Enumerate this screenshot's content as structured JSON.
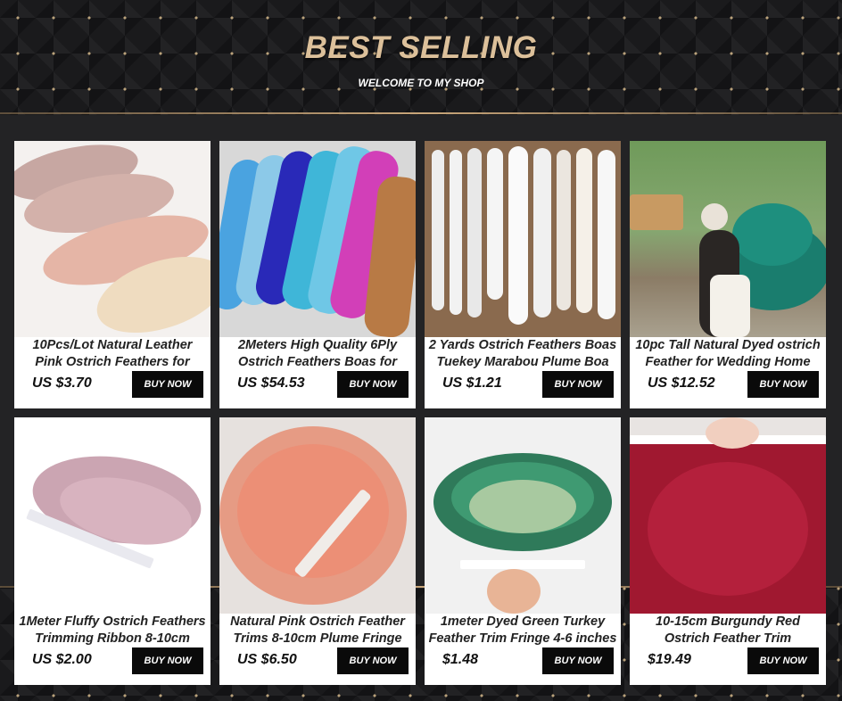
{
  "header": {
    "title": "BEST SELLING",
    "subtitle": "WELCOME TO MY SHOP"
  },
  "colors": {
    "gold": "#dcc09a",
    "background": "#1a1a1c",
    "button": "#0a0a0a"
  },
  "products": [
    {
      "line1": "10Pcs/Lot Natural Leather",
      "line2": "Pink Ostrich Feathers for",
      "price": "US $3.70",
      "button": "BUY NOW"
    },
    {
      "line1": "2Meters High Quality 6Ply",
      "line2": "Ostrich Feathers Boas for",
      "price": "US $54.53",
      "button": "BUY NOW"
    },
    {
      "line1": "2 Yards Ostrich Feathers Boas",
      "line2": "Tuekey Marabou Plume Boa",
      "price": "US $1.21",
      "button": "BUY NOW"
    },
    {
      "line1": "10pc Tall Natural Dyed ostrich",
      "line2": "Feather for Wedding Home",
      "price": "US $12.52",
      "button": "BUY NOW"
    },
    {
      "line1": "1Meter Fluffy Ostrich Feathers",
      "line2": "Trimming Ribbon 8-10cm",
      "price": "US $2.00",
      "button": "BUY NOW"
    },
    {
      "line1": "Natural Pink Ostrich Feather",
      "line2": "Trims 8-10cm Plume Fringe",
      "price": "US $6.50",
      "button": "BUY NOW"
    },
    {
      "line1": "1meter Dyed Green Turkey",
      "line2": "Feather Trim Fringe 4-6 inches",
      "price": "$1.48",
      "button": "BUY NOW"
    },
    {
      "line1": "10-15cm Burgundy Red",
      "line2": "Ostrich Feather Trim",
      "price": "$19.49",
      "button": "BUY NOW"
    }
  ]
}
